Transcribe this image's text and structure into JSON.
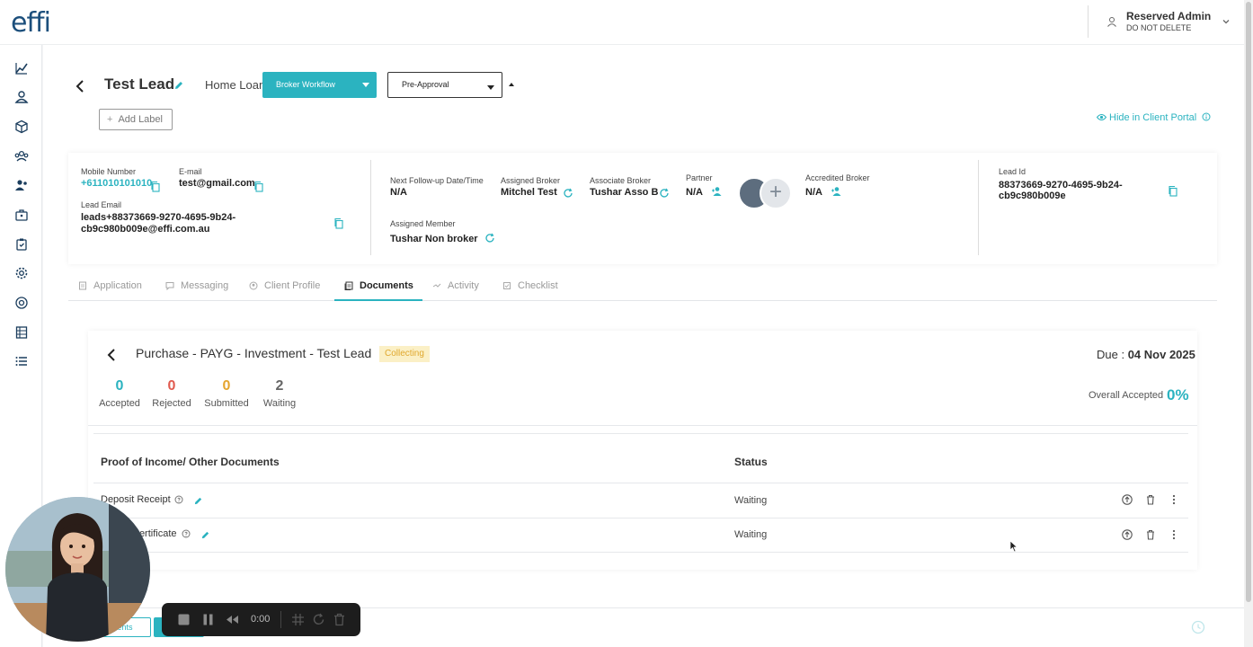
{
  "app": {
    "logo": "effi",
    "user": {
      "name": "Reserved Admin",
      "subtitle": "DO NOT DELETE"
    }
  },
  "sidebar": {
    "items": [
      "chart-line-icon",
      "person-money-icon",
      "cube-icon",
      "users-group-icon",
      "user-icon",
      "briefcase-icon",
      "clipboard-check-icon",
      "settings-cog-icon",
      "dollar-circle-icon",
      "table-icon",
      "list-icon"
    ]
  },
  "lead": {
    "title": "Test Lead",
    "loan_type": "Home Loan",
    "workflow": "Broker Workflow",
    "stage": "Pre-Approval",
    "add_label": "Add Label",
    "hide_portal": "Hide in Client Portal"
  },
  "details": {
    "mobile_label": "Mobile Number",
    "mobile": "+611010101010",
    "email_label": "E-mail",
    "email": "test@gmail.com",
    "lead_email_label": "Lead Email",
    "lead_email_line1": "leads+88373669-9270-4695-9b24-",
    "lead_email_line2": "cb9c980b009e@effi.com.au",
    "followup_label": "Next Follow-up Date/Time",
    "followup": "N/A",
    "assigned_broker_label": "Assigned Broker",
    "assigned_broker": "Mitchel Test",
    "associate_broker_label": "Associate Broker",
    "associate_broker": "Tushar Asso B",
    "partner_label": "Partner",
    "partner": "N/A",
    "accredited_label": "Accredited Broker",
    "accredited": "N/A",
    "assigned_member_label": "Assigned Member",
    "assigned_member": "Tushar Non broker",
    "lead_id_label": "Lead Id",
    "lead_id_line1": "88373669-9270-4695-9b24-",
    "lead_id_line2": "cb9c980b009e"
  },
  "tabs": [
    {
      "label": "Application",
      "icon": "document-icon",
      "active": false
    },
    {
      "label": "Messaging",
      "icon": "message-icon",
      "active": false
    },
    {
      "label": "Client Profile",
      "icon": "profile-icon",
      "active": false
    },
    {
      "label": "Documents",
      "icon": "documents-icon",
      "active": true
    },
    {
      "label": "Activity",
      "icon": "activity-icon",
      "active": false
    },
    {
      "label": "Checklist",
      "icon": "checklist-icon",
      "active": false
    }
  ],
  "documents": {
    "title": "Purchase - PAYG - Investment - Test Lead",
    "badge": "Collecting",
    "due_label": "Due :",
    "due_date": "04 Nov 2025",
    "stats": [
      {
        "value": "0",
        "label": "Accepted",
        "color": "#2bb3c0"
      },
      {
        "value": "0",
        "label": "Rejected",
        "color": "#e05a4f"
      },
      {
        "value": "0",
        "label": "Submitted",
        "color": "#e5a52f"
      },
      {
        "value": "2",
        "label": "Waiting",
        "color": "#666666"
      }
    ],
    "overall_label": "Overall Accepted",
    "overall_value": "0%",
    "table": {
      "section_header": "Proof of Income/ Other Documents",
      "status_header": "Status",
      "rows": [
        {
          "name": "Deposit Receipt",
          "status": "Waiting"
        },
        {
          "name": "Certificate",
          "status": "Waiting"
        }
      ]
    }
  },
  "bottom": {
    "button_label": "ents"
  },
  "recorder": {
    "time": "0:00"
  },
  "colors": {
    "accent": "#2bb3c0",
    "brand": "#1c4f7c",
    "badge_bg": "#fbf0c6",
    "badge_text": "#e0a82e"
  }
}
